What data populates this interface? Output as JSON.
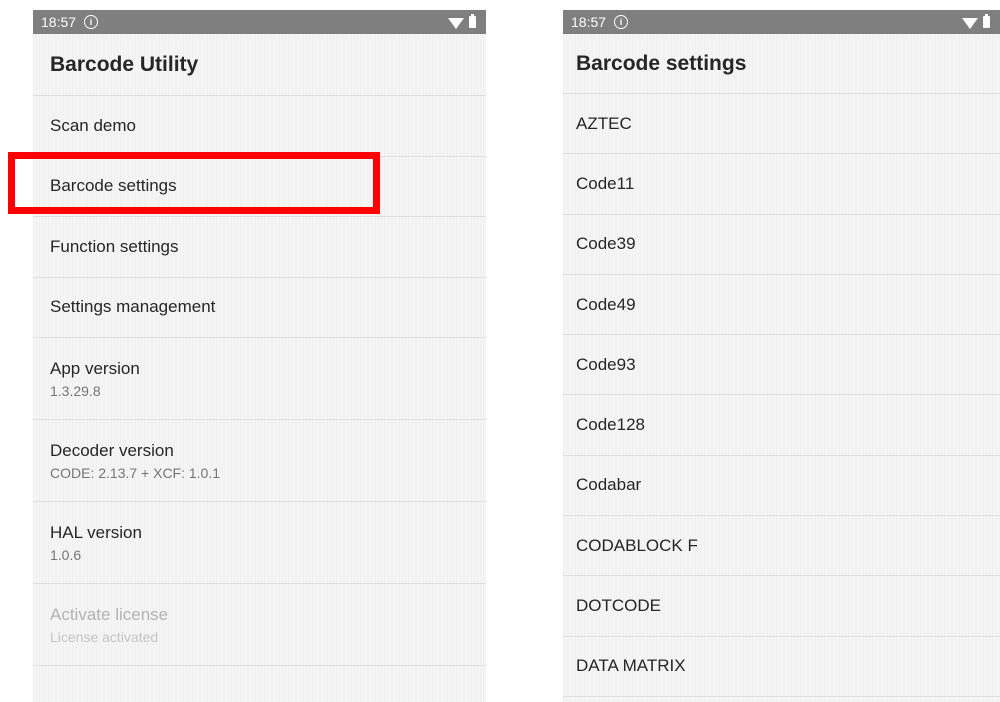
{
  "left_screen": {
    "status": {
      "time": "18:57",
      "info_glyph": "i"
    },
    "title": "Barcode Utility",
    "items": [
      {
        "title": "Scan demo",
        "subtitle": ""
      },
      {
        "title": "Barcode settings",
        "subtitle": "",
        "highlighted": true
      },
      {
        "title": "Function settings",
        "subtitle": ""
      },
      {
        "title": "Settings management",
        "subtitle": ""
      },
      {
        "title": "App version",
        "subtitle": "1.3.29.8"
      },
      {
        "title": "Decoder version",
        "subtitle": "CODE: 2.13.7 + XCF: 1.0.1"
      },
      {
        "title": "HAL version",
        "subtitle": "1.0.6"
      },
      {
        "title": "Activate license",
        "subtitle": "License activated",
        "disabled": true
      }
    ]
  },
  "right_screen": {
    "status": {
      "time": "18:57",
      "info_glyph": "i"
    },
    "title": "Barcode settings",
    "items": [
      {
        "title": "AZTEC"
      },
      {
        "title": "Code11"
      },
      {
        "title": "Code39"
      },
      {
        "title": "Code49"
      },
      {
        "title": "Code93"
      },
      {
        "title": "Code128"
      },
      {
        "title": "Codabar"
      },
      {
        "title": "CODABLOCK F"
      },
      {
        "title": "DOTCODE"
      },
      {
        "title": "DATA MATRIX"
      }
    ]
  },
  "annotation": {
    "highlight_color": "#ff0000",
    "highlight_target": "Barcode settings"
  },
  "icons": {
    "status": [
      "info-icon",
      "wifi-icon",
      "battery-icon"
    ]
  }
}
